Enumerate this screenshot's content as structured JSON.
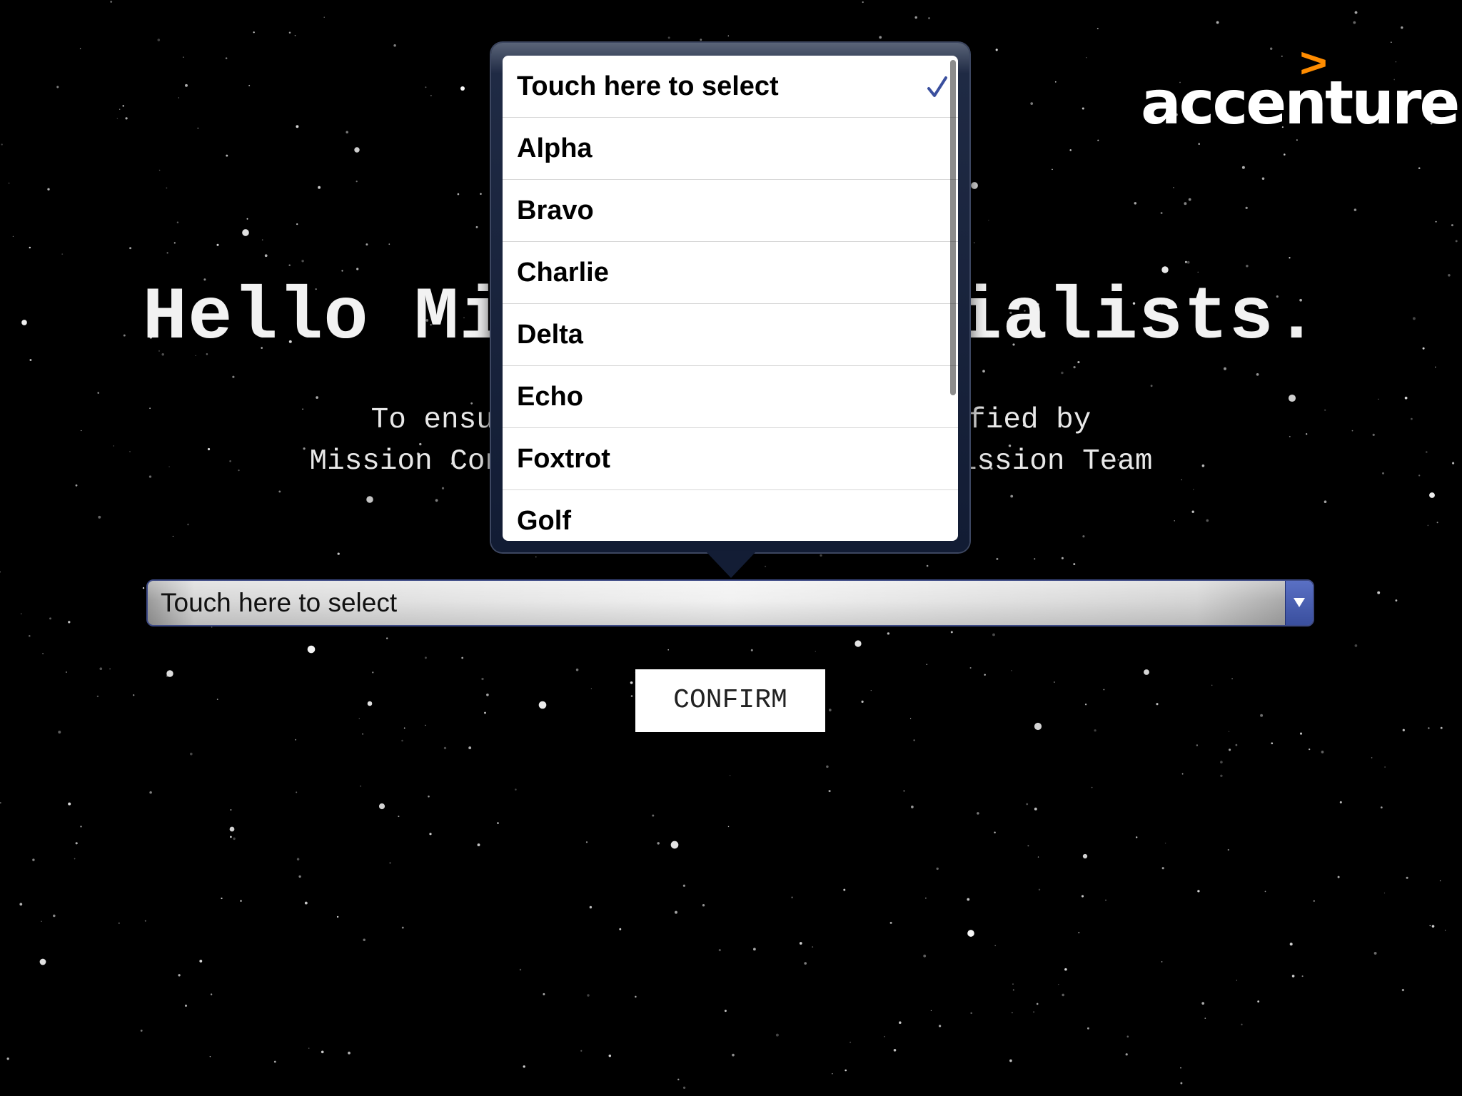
{
  "brand": {
    "logo_arrow": ">",
    "logo_text": "accenture",
    "accent_color": "#ff8c00"
  },
  "main": {
    "headline": "Hello Mission Specialists.",
    "subtitle_lines": [
      "To ensure you are correctly identified by",
      "Mission Control, please select your Mission Team"
    ]
  },
  "team_select": {
    "selected_label": "Touch here to select",
    "arrow_icon": "triangle-down-icon",
    "options": [
      {
        "label": "Touch here to select",
        "selected": true
      },
      {
        "label": "Alpha",
        "selected": false
      },
      {
        "label": "Bravo",
        "selected": false
      },
      {
        "label": "Charlie",
        "selected": false
      },
      {
        "label": "Delta",
        "selected": false
      },
      {
        "label": "Echo",
        "selected": false
      },
      {
        "label": "Foxtrot",
        "selected": false
      },
      {
        "label": "Golf",
        "selected": false
      }
    ],
    "check_icon": "checkmark-icon",
    "check_color": "#3a4f9e"
  },
  "actions": {
    "confirm_label": "CONFIRM"
  }
}
